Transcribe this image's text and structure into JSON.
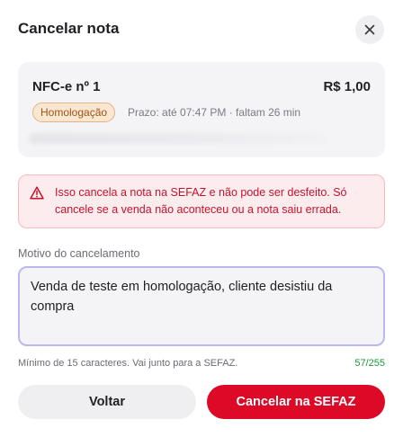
{
  "dialog": {
    "title": "Cancelar nota"
  },
  "note": {
    "title": "NFC-e nº 1",
    "amount": "R$ 1,00",
    "environment_badge": "Homologação",
    "deadline_text": "Prazo: até 07:47 PM · faltam 26 min"
  },
  "warning": {
    "text": "Isso cancela a nota na SEFAZ e não pode ser desfeito. Só cancele se a venda não aconteceu ou a nota saiu errada."
  },
  "reason": {
    "label": "Motivo do cancelamento",
    "value": "Venda de teste em homologação, cliente desistiu da compra",
    "hint": "Mínimo de 15 caracteres. Vai junto para a SEFAZ.",
    "counter": "57/255"
  },
  "actions": {
    "back_label": "Voltar",
    "confirm_label": "Cancelar na SEFAZ"
  },
  "icons": {
    "close": "close-icon",
    "warning": "warning-icon"
  },
  "colors": {
    "danger": "#dc0a26",
    "warning_text": "#c4122e",
    "badge_bg": "#fbe7d0",
    "counter_ok": "#1c9a3a",
    "focus_border": "#b9b9ef"
  }
}
